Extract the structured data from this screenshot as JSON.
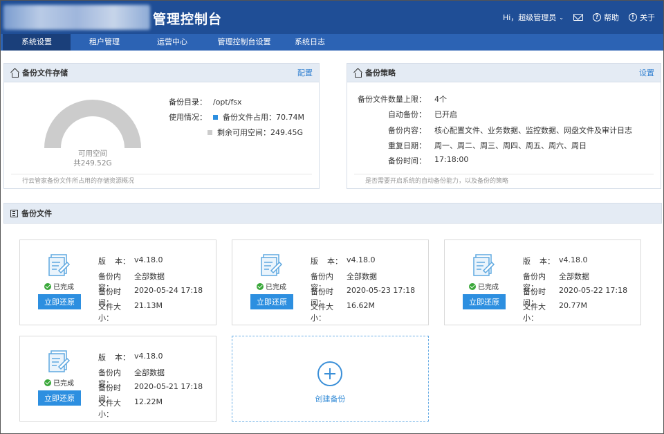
{
  "header": {
    "title": "管理控制台",
    "greeting": "Hi，超级管理员",
    "help": "帮助",
    "about": "关于"
  },
  "nav": {
    "tabs": [
      {
        "label": "系统设置",
        "active": true
      },
      {
        "label": "租户管理"
      },
      {
        "label": "运营中心"
      },
      {
        "label": "管理控制台设置"
      },
      {
        "label": "系统日志"
      }
    ]
  },
  "storage": {
    "title": "备份文件存储",
    "action": "配置",
    "gauge_label": "可用空间",
    "gauge_total": "共249.52G",
    "dir_label": "备份目录：",
    "dir_value": "/opt/fsx",
    "usage_label": "使用情况：",
    "used_label": "备份文件占用：",
    "used_value": "70.74M",
    "free_label": "剩余可用空间：",
    "free_value": "249.45G",
    "footer": "行云管家备份文件所占用的存储资源概况",
    "colors": {
      "used": "#2d8fe0",
      "free": "#cccccc"
    }
  },
  "strategy": {
    "title": "备份策略",
    "action": "设置",
    "rows": [
      {
        "k": "备份文件数量上限：",
        "v": "4个"
      },
      {
        "k": "自动备份：",
        "v": "已开启"
      },
      {
        "k": "备份内容：",
        "v": "核心配置文件、业务数据、监控数据、网盘文件及审计日志"
      },
      {
        "k": "重复日期：",
        "v": "周一、周二、周三、周四、周五、周六、周日"
      },
      {
        "k": "备份时间：",
        "v": "17:18:00"
      }
    ],
    "footer": "是否需要开启系统的自动备份能力，以及备份的策略"
  },
  "files": {
    "title": "备份文件",
    "labels": {
      "version_a": "版",
      "version_b": "本：",
      "content": "备份内容：",
      "time": "备份时间：",
      "size": "文件大小：",
      "status": "已完成",
      "restore": "立即还原"
    },
    "cards": [
      {
        "version": "v4.18.0",
        "content": "全部数据",
        "time": "2020-05-24 17:18",
        "size": "21.13M"
      },
      {
        "version": "v4.18.0",
        "content": "全部数据",
        "time": "2020-05-23 17:18",
        "size": "16.62M"
      },
      {
        "version": "v4.18.0",
        "content": "全部数据",
        "time": "2020-05-22 17:18",
        "size": "20.77M"
      },
      {
        "version": "v4.18.0",
        "content": "全部数据",
        "time": "2020-05-21 17:18",
        "size": "12.22M"
      }
    ],
    "create_label": "创建备份"
  }
}
